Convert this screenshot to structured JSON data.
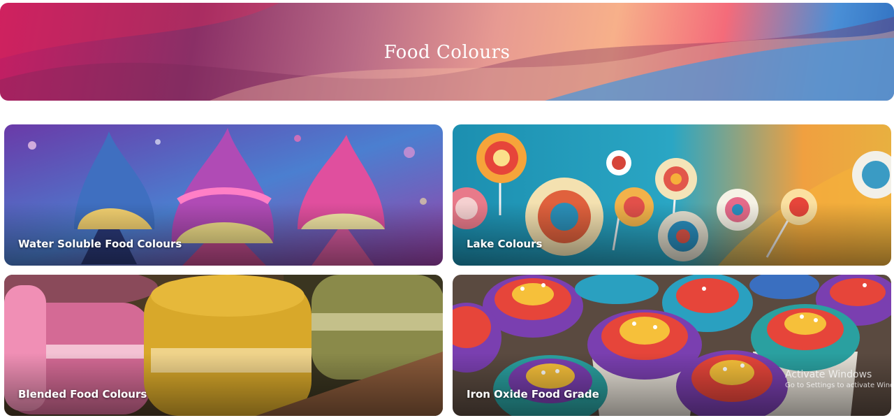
{
  "header": {
    "title": "Food Colours"
  },
  "categories": [
    {
      "label": "Water Soluble Food Colours",
      "image": "ice-cream-cones"
    },
    {
      "label": "Lake Colours",
      "image": "lollipops"
    },
    {
      "label": "Blended Food Colours",
      "image": "macarons"
    },
    {
      "label": "Iron Oxide Food Grade",
      "image": "rainbow-cupcakes"
    }
  ],
  "watermark": {
    "line1": "Activate Windows",
    "line2": "Go to Settings to activate Windows."
  },
  "colors": {
    "hero_magenta": "#c41e63",
    "hero_peach": "#f7b08a",
    "hero_blue": "#2f6fc0",
    "label_text": "#ffffff"
  }
}
